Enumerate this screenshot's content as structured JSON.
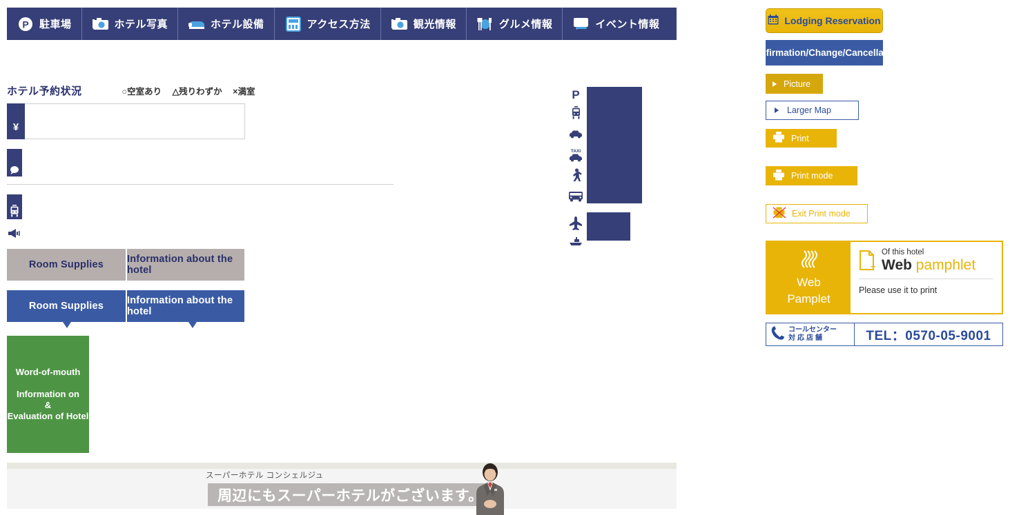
{
  "nav": {
    "items": [
      {
        "icon": "parking-icon",
        "label": "駐車場"
      },
      {
        "icon": "camera-icon",
        "label": "ホテル写真"
      },
      {
        "icon": "bed-icon",
        "label": "ホテル設備"
      },
      {
        "icon": "map-icon",
        "label": "アクセス方法"
      },
      {
        "icon": "camera-icon",
        "label": "観光情報"
      },
      {
        "icon": "cutlery-icon",
        "label": "グルメ情報"
      },
      {
        "icon": "speech-icon",
        "label": "イベント情報"
      }
    ]
  },
  "reservation": {
    "title": "ホテル予約状況",
    "legend": {
      "available": "○空室あり",
      "few": "△残りわずか",
      "full": "×満室"
    },
    "yen_symbol": "¥"
  },
  "tabs": {
    "inactive": [
      {
        "label": "Room Supplies"
      },
      {
        "label": "Information about the hotel"
      }
    ],
    "active": [
      {
        "label": "Room Supplies"
      },
      {
        "label": "Information about the hotel"
      }
    ]
  },
  "review_box": {
    "line1": "Word-of-mouth",
    "line2": "Information on",
    "line3": "&",
    "line4": "Evaluation of Hotel"
  },
  "transport_icons": [
    "parking-icon",
    "train-icon",
    "car-icon",
    "taxi-icon",
    "walk-icon",
    "bus-icon",
    "airplane-icon",
    "boat-icon"
  ],
  "sidebar": {
    "lodging": {
      "icon": "calendar-icon",
      "label": "Lodging Reservation"
    },
    "confirmation": {
      "label": "Confirmation/Change/Cancellation"
    },
    "picture": {
      "icon": "triangle-right-icon",
      "label": "Picture"
    },
    "larger_map": {
      "icon": "triangle-right-icon",
      "label": "Larger Map"
    },
    "print": {
      "icon": "printer-icon",
      "label": "Print"
    },
    "print_mode": {
      "icon": "printer-icon",
      "label": "Print mode"
    },
    "exit_print_mode": {
      "icon": "printer-crossed-icon",
      "label": "Exit Print mode"
    }
  },
  "pamphlet": {
    "badge_line1": "Web",
    "badge_line2": "Pamplet",
    "of_this_hotel": "Of this hotel",
    "web": "Web",
    "pamphlet": "pamphlet",
    "note": "Please use it to print",
    "doc_icon": "document-plus-icon"
  },
  "telbar": {
    "icon": "phone-icon",
    "cc_line1": "コールセンター",
    "cc_line2": "対応店舗",
    "number": "TEL：0570-05-9001"
  },
  "footer": {
    "subtitle": "スーパーホテル コンシェルジュ",
    "message": "周辺にもスーパーホテルがございます。",
    "avatar": "concierge-avatar"
  },
  "colors": {
    "navy": "#363f77",
    "blue": "#3a5ba4",
    "gold": "#e8b408",
    "green": "#4e9445",
    "grey_tab": "#b5aeac"
  }
}
